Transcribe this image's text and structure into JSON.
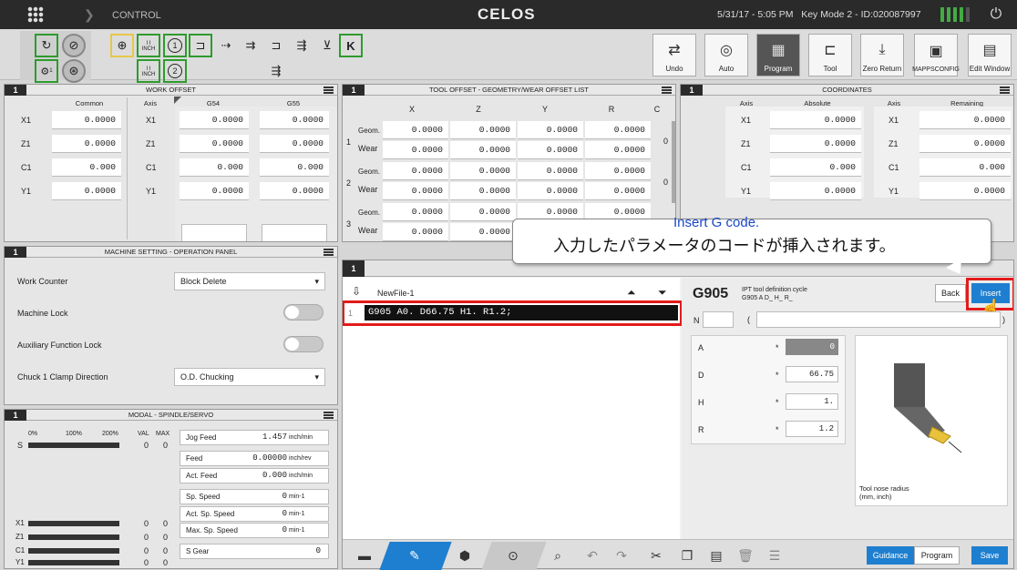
{
  "topbar": {
    "title": "CONTROL",
    "brand": "CELOS",
    "status": "5/31/17 - 5:05 PM   Key Mode 2 - ID:020087997"
  },
  "toolbar": {
    "inch1": "INCH",
    "inch2": "INCH",
    "num1": "1",
    "num2": "2",
    "num3": "1"
  },
  "side_buttons": [
    {
      "label": "Undo",
      "icon": "undo-icon"
    },
    {
      "label": "Auto",
      "icon": "auto-icon"
    },
    {
      "label": "Program",
      "icon": "program-icon"
    },
    {
      "label": "Tool",
      "icon": "tool-icon"
    },
    {
      "label": "Zero Return",
      "icon": "zero-return-icon"
    },
    {
      "label": "MAPPSCONFIG",
      "icon": "mappsconfig-icon"
    },
    {
      "label": "Edit Window",
      "icon": "edit-window-icon"
    }
  ],
  "work_offset": {
    "num": "1",
    "title": "WORK OFFSET",
    "axis_label": "Axis",
    "common_label": "Common",
    "g54": "G54",
    "g55": "G55",
    "rows": [
      {
        "axis": "X1",
        "common": "0.0000",
        "g54": "0.0000",
        "g55": "0.0000"
      },
      {
        "axis": "Z1",
        "common": "0.0000",
        "g54": "0.0000",
        "g55": "0.0000"
      },
      {
        "axis": "C1",
        "common": "0.000",
        "g54": "0.000",
        "g55": "0.000"
      },
      {
        "axis": "Y1",
        "common": "0.0000",
        "g54": "0.0000",
        "g55": "0.0000"
      }
    ]
  },
  "tool_offset": {
    "num": "1",
    "title": "TOOL OFFSET - GEOMETRY/WEAR OFFSET LIST",
    "cols": [
      "X",
      "Z",
      "Y",
      "R",
      "C"
    ],
    "geom_label": "Geom.",
    "wear_label": "Wear",
    "rows": [
      {
        "n": "1",
        "geom": [
          "0.0000",
          "0.0000",
          "0.0000",
          "0.0000"
        ],
        "wear": [
          "0.0000",
          "0.0000",
          "0.0000",
          "0.0000"
        ],
        "c": "0"
      },
      {
        "n": "2",
        "geom": [
          "0.0000",
          "0.0000",
          "0.0000",
          "0.0000"
        ],
        "wear": [
          "0.0000",
          "0.0000",
          "0.0000",
          "0.0000"
        ],
        "c": "0"
      },
      {
        "n": "3",
        "geom": [
          "0.0000",
          "0.0000",
          "0.0000",
          "0.0000"
        ],
        "wear": [
          "0.0000",
          "0.0000"
        ],
        "c": ""
      }
    ]
  },
  "coordinates": {
    "num": "1",
    "title": "COORDINATES",
    "axis_label": "Axis",
    "absolute_label": "Absolute",
    "remaining_label": "Remaining",
    "rows": [
      {
        "axis": "X1",
        "abs": "0.0000",
        "rem": "0.0000"
      },
      {
        "axis": "Z1",
        "abs": "0.0000",
        "rem": "0.0000"
      },
      {
        "axis": "C1",
        "abs": "0.000",
        "rem": "0.000"
      },
      {
        "axis": "Y1",
        "abs": "0.0000",
        "rem": "0.0000"
      }
    ]
  },
  "machine": {
    "num": "1",
    "title": "MACHINE SETTING - OPERATION PANEL",
    "work_counter": "Work Counter",
    "work_counter_val": "Block Delete",
    "machine_lock": "Machine Lock",
    "aux_lock": "Auxiliary Function Lock",
    "chuck": "Chuck 1 Clamp Direction",
    "chuck_val": "O.D. Chucking"
  },
  "modal": {
    "num": "1",
    "title": "MODAL - SPINDLE/SERVO",
    "p0": "0%",
    "p100": "100%",
    "p200": "200%",
    "val": "VAL",
    "max": "MAX",
    "s": "S",
    "s_val": "0",
    "s_max": "0",
    "axes": [
      {
        "a": "X1",
        "v": "0",
        "m": "0"
      },
      {
        "a": "Z1",
        "v": "0",
        "m": "0"
      },
      {
        "a": "C1",
        "v": "0",
        "m": "0"
      },
      {
        "a": "Y1",
        "v": "0",
        "m": "0"
      }
    ],
    "jog_feed": {
      "label": "Jog Feed",
      "value": "1.457",
      "unit": "inch/min"
    },
    "feed": {
      "label": "Feed",
      "value": "0.00000",
      "unit": "inch/rev"
    },
    "act_feed": {
      "label": "Act. Feed",
      "value": "0.000",
      "unit": "inch/min"
    },
    "sp_speed": {
      "label": "Sp. Speed",
      "value": "0",
      "unit": "min-1"
    },
    "act_sp_speed": {
      "label": "Act. Sp. Speed",
      "value": "0",
      "unit": "min-1"
    },
    "max_sp_speed": {
      "label": "Max. Sp. Speed",
      "value": "0",
      "unit": "min-1"
    },
    "s_gear": {
      "label": "S Gear",
      "value": "0"
    }
  },
  "editor": {
    "num": "1",
    "file": "NewFile-1",
    "line_no": "1",
    "code": "G905 A0. D66.75 H1. R1.2;"
  },
  "g905": {
    "code": "G905",
    "desc1": "IPT tool definition cycle",
    "desc2": "G905 A D_ H_ R_",
    "back": "Back",
    "insert": "Insert",
    "n_label": "N",
    "paren_open": "(",
    "paren_close": ")",
    "params": [
      {
        "k": "A",
        "v": "0"
      },
      {
        "k": "D",
        "v": "66.75"
      },
      {
        "k": "H",
        "v": "1."
      },
      {
        "k": "R",
        "v": "1.2"
      }
    ],
    "star": "*",
    "img_caption1": "Tool nose radius",
    "img_caption2": "(mm, inch)"
  },
  "callout": {
    "line1": "Insert G code.",
    "line2": "入力したパラメータのコードが挿入されます。"
  },
  "bottom": {
    "guidance": "Guidance",
    "program": "Program",
    "save": "Save"
  }
}
